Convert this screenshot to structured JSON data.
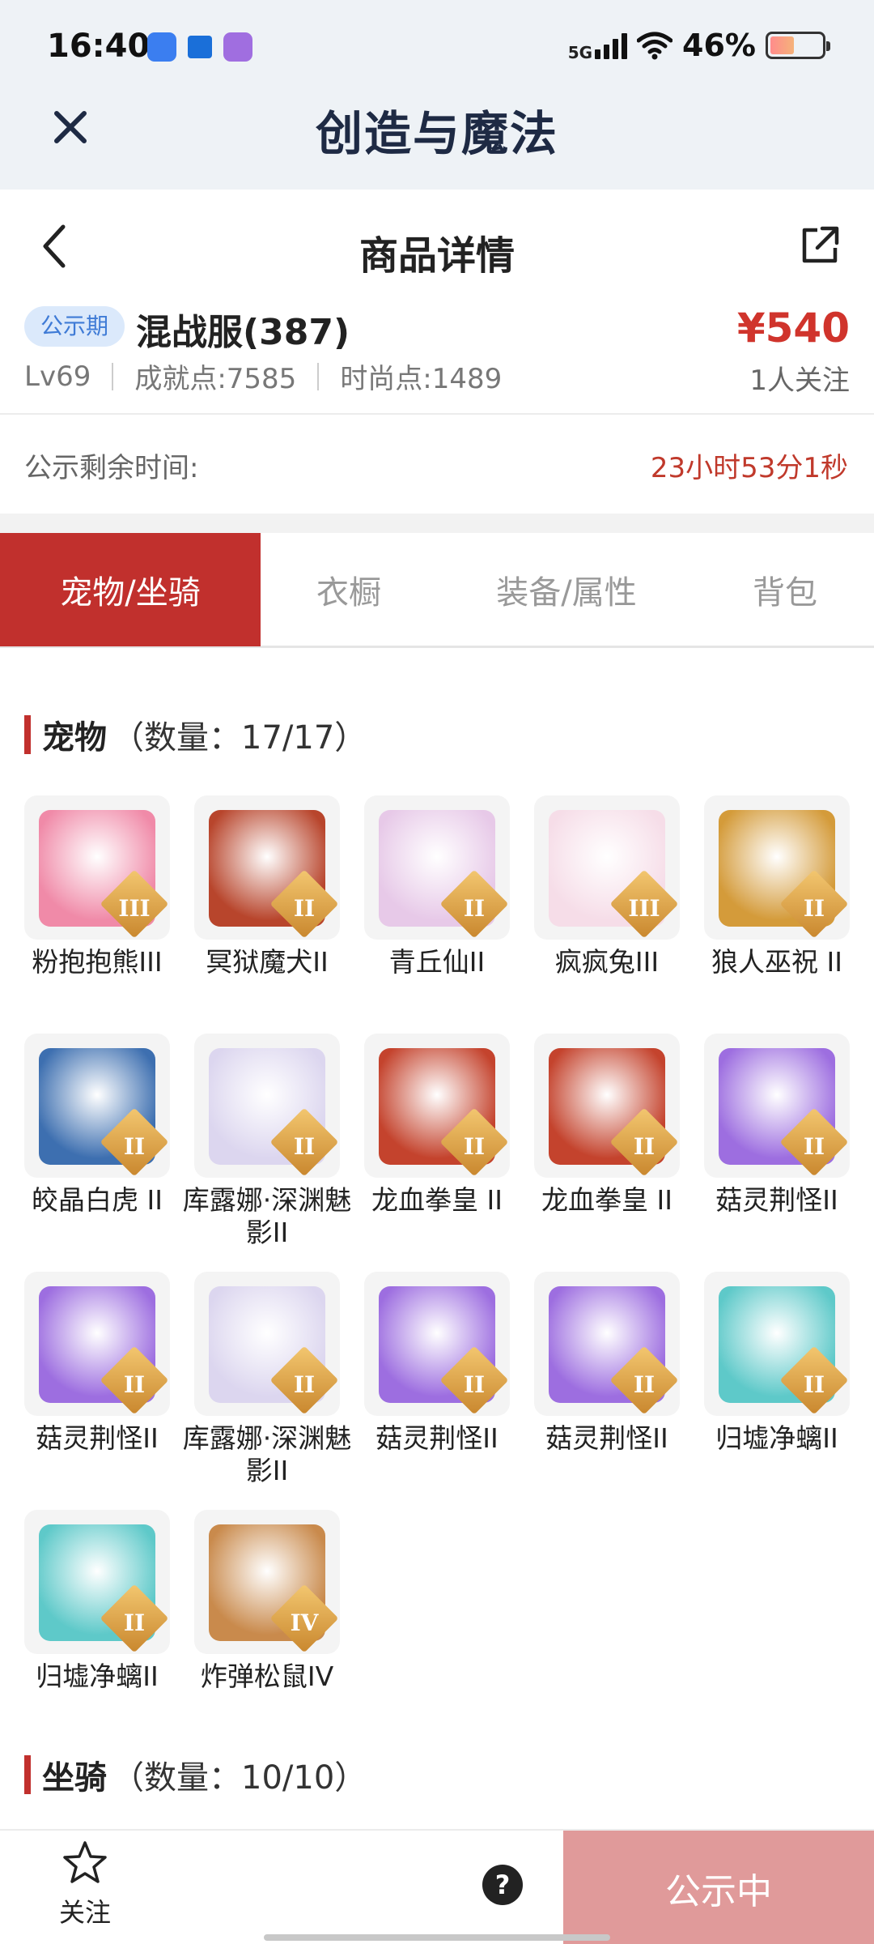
{
  "status_bar": {
    "time": "16:40",
    "network": "5G",
    "battery": "46%"
  },
  "app": {
    "title": "创造与魔法"
  },
  "page": {
    "title": "商品详情"
  },
  "product": {
    "badge": "公示期",
    "server": "混战服(387)",
    "level": "Lv69",
    "achievement": "成就点:7585",
    "fashion": "时尚点:1489",
    "price": "¥540",
    "followers": "1人关注"
  },
  "countdown": {
    "label": "公示剩余时间:",
    "value": "23小时53分1秒"
  },
  "tabs": [
    {
      "label": "宠物/坐骑",
      "active": true
    },
    {
      "label": "衣橱",
      "active": false
    },
    {
      "label": "装备/属性",
      "active": false
    },
    {
      "label": "背包",
      "active": false
    }
  ],
  "pets_section": {
    "title": "宠物",
    "count": "（数量：17/17）"
  },
  "pets": [
    {
      "name": "粉抱抱熊III",
      "tier": "III",
      "icon": "pink-bear-icon",
      "color": "#f08aa8"
    },
    {
      "name": "冥狱魔犬II",
      "tier": "II",
      "icon": "dragon-dog-icon",
      "color": "#b8452c"
    },
    {
      "name": "青丘仙II",
      "tier": "II",
      "icon": "fox-fairy-icon",
      "color": "#e7c9e8"
    },
    {
      "name": "疯疯兔III",
      "tier": "III",
      "icon": "crazy-rabbit-icon",
      "color": "#f6dde8"
    },
    {
      "name": "狼人巫祝 II",
      "tier": "II",
      "icon": "wolf-shaman-icon",
      "color": "#d49b3a"
    },
    {
      "name": "皎晶白虎 II",
      "tier": "II",
      "icon": "white-tiger-icon",
      "color": "#3d6fb0"
    },
    {
      "name": "库露娜·深渊魅影II",
      "tier": "II",
      "icon": "kuluna-icon",
      "color": "#dcd6ef"
    },
    {
      "name": "龙血拳皇 II",
      "tier": "II",
      "icon": "dragon-boxer-icon",
      "color": "#c4432d"
    },
    {
      "name": "龙血拳皇 II",
      "tier": "II",
      "icon": "dragon-boxer-icon",
      "color": "#c4432d"
    },
    {
      "name": "菇灵荆怪II",
      "tier": "II",
      "icon": "mushroom-sprite-icon",
      "color": "#9d6ee0"
    },
    {
      "name": "菇灵荆怪II",
      "tier": "II",
      "icon": "mushroom-sprite-icon",
      "color": "#9d6ee0"
    },
    {
      "name": "库露娜·深渊魅影II",
      "tier": "II",
      "icon": "kuluna-icon",
      "color": "#dcd6ef"
    },
    {
      "name": "菇灵荆怪II",
      "tier": "II",
      "icon": "mushroom-sprite-icon",
      "color": "#9d6ee0"
    },
    {
      "name": "菇灵荆怪II",
      "tier": "II",
      "icon": "mushroom-sprite-icon",
      "color": "#9d6ee0"
    },
    {
      "name": "归墟净螭II",
      "tier": "II",
      "icon": "jade-dragon-icon",
      "color": "#5ec9c9"
    },
    {
      "name": "归墟净螭II",
      "tier": "II",
      "icon": "jade-dragon-icon",
      "color": "#5ec9c9"
    },
    {
      "name": "炸弹松鼠IV",
      "tier": "IV",
      "icon": "bomb-squirrel-icon",
      "color": "#c98a4c"
    }
  ],
  "mounts_section": {
    "title": "坐骑",
    "count": "（数量：10/10）"
  },
  "bottom": {
    "follow": "关注",
    "help": "?",
    "action": "公示中"
  },
  "colors": {
    "accent": "#c1302d",
    "price": "#d0342c",
    "badge_bg": "#dbe9fb",
    "action_bg": "#e09a9a"
  }
}
